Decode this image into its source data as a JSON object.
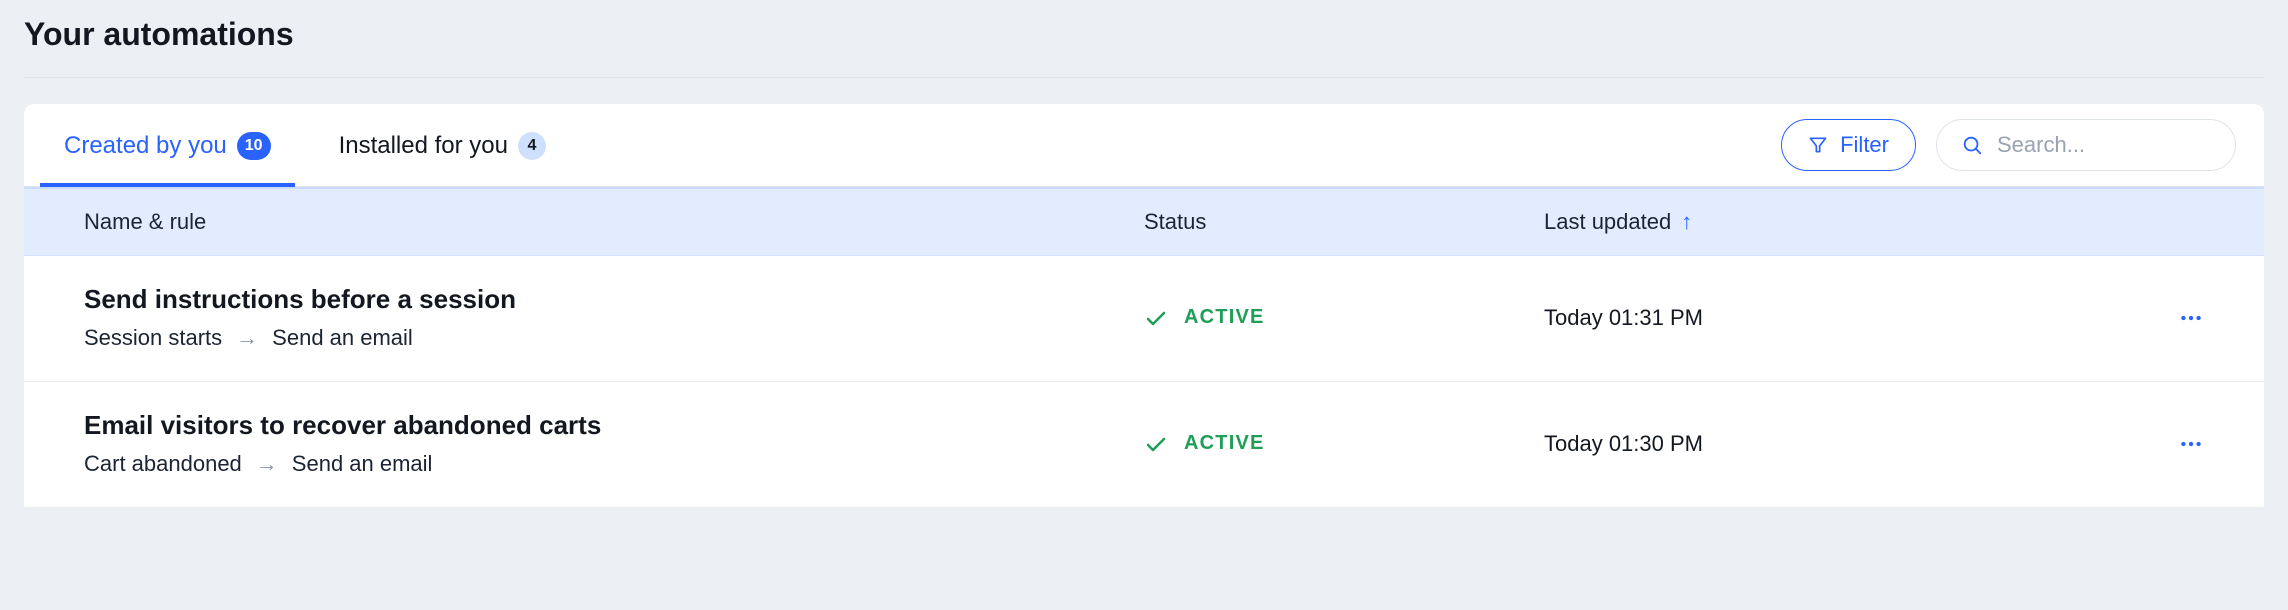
{
  "header": {
    "title": "Your automations"
  },
  "tabs": {
    "created": {
      "label": "Created by you",
      "count": "10"
    },
    "installed": {
      "label": "Installed for you",
      "count": "4"
    }
  },
  "toolbar": {
    "filter_label": "Filter",
    "search_placeholder": "Search..."
  },
  "columns": {
    "name": "Name & rule",
    "status": "Status",
    "updated": "Last updated"
  },
  "rows": [
    {
      "title": "Send instructions before a session",
      "trigger": "Session starts",
      "action": "Send an email",
      "status": "ACTIVE",
      "updated": "Today 01:31 PM"
    },
    {
      "title": "Email visitors to recover abandoned carts",
      "trigger": "Cart abandoned",
      "action": "Send an email",
      "status": "ACTIVE",
      "updated": "Today 01:30 PM"
    }
  ]
}
